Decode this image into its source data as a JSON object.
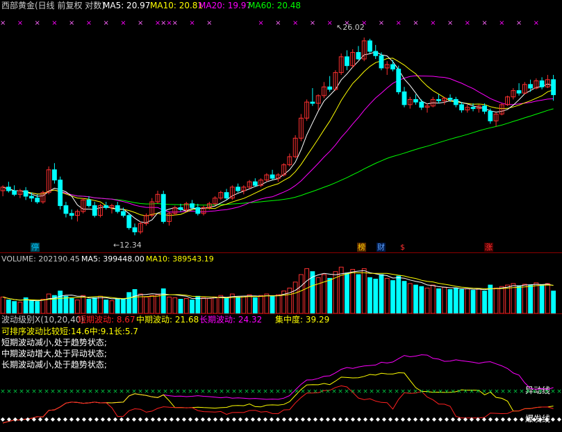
{
  "colors": {
    "ma5": "#ffffff",
    "ma10": "#ffff00",
    "ma20": "#ff00ff",
    "ma60": "#00ff00",
    "up": "#ff3030",
    "down": "#00ffff",
    "short": "#ff2020",
    "mid": "#ffff00",
    "long": "#ff00ff"
  },
  "price_header": {
    "title": "西部黄金(日线 前复权 对数)",
    "ma5": "MA5: 20.97",
    "ma10": "MA10: 20.81",
    "ma20": "MA20: 19.97",
    "ma60": "MA60: 20.48"
  },
  "price_annotations": {
    "high": "26.02",
    "low": "12.34"
  },
  "event_tags": {
    "t1": "停",
    "t2": "榜",
    "t3": "财",
    "t4": "$",
    "t5": "涨"
  },
  "volume_header": {
    "label": "VOLUME: 202190.45",
    "ma5": "MA5: 399448.00",
    "ma10": "MA10: 389543.19"
  },
  "wave_header": {
    "name": "波动级别X(10,20,40)",
    "short": "短期波动: 8.67",
    "mid": "中期波动: 21.68",
    "long": "长期波动: 24.32",
    "conc": "集中度: 39.29"
  },
  "wave_notes": {
    "line1": "可排序波动比较短:14.6中:9.1长:5.7",
    "line2": "短期波动减小,处于趋势状态;",
    "line3": "中期波动增大,处于异动状态;",
    "line4": "长期波动减小,处于趋势状态;"
  },
  "wave_labels": {
    "abnormal": "异动线",
    "explosive": "爆发线"
  },
  "icons": {
    "marker": "x-marker-icon",
    "pointer": "arrow-pointer-icon"
  },
  "chart_data": [
    {
      "type": "line",
      "title": "西部黄金(日线 前复权 对数)",
      "series": [
        {
          "name": "MA5",
          "last": 20.97
        },
        {
          "name": "MA10",
          "last": 20.81
        },
        {
          "name": "MA20",
          "last": 19.97
        },
        {
          "name": "MA60",
          "last": 20.48
        }
      ],
      "candles": [
        [
          14.6,
          14.9,
          14.3,
          14.8
        ],
        [
          14.8,
          15.1,
          14.5,
          14.6
        ],
        [
          14.6,
          14.9,
          14.3,
          14.4
        ],
        [
          14.4,
          14.7,
          14.2,
          14.6
        ],
        [
          14.6,
          14.8,
          14.1,
          14.3
        ],
        [
          14.3,
          14.5,
          14.0,
          14.2
        ],
        [
          14.2,
          14.4,
          13.9,
          14.0
        ],
        [
          14.0,
          14.6,
          13.9,
          14.5
        ],
        [
          14.5,
          16.0,
          14.4,
          15.8
        ],
        [
          15.8,
          16.2,
          15.0,
          15.2
        ],
        [
          15.2,
          15.4,
          13.6,
          13.8
        ],
        [
          13.8,
          14.0,
          13.2,
          13.4
        ],
        [
          13.4,
          13.6,
          13.1,
          13.3
        ],
        [
          13.3,
          13.6,
          13.0,
          13.5
        ],
        [
          13.5,
          14.2,
          13.4,
          14.1
        ],
        [
          14.1,
          14.3,
          13.7,
          13.8
        ],
        [
          13.8,
          14.0,
          13.2,
          13.3
        ],
        [
          13.3,
          13.9,
          13.2,
          13.8
        ],
        [
          13.8,
          14.0,
          13.6,
          13.7
        ],
        [
          13.7,
          13.9,
          13.4,
          13.8
        ],
        [
          13.8,
          14.0,
          13.4,
          13.5
        ],
        [
          13.5,
          13.7,
          13.2,
          13.3
        ],
        [
          13.3,
          13.4,
          12.6,
          12.7
        ],
        [
          12.7,
          12.9,
          12.34,
          12.5
        ],
        [
          12.5,
          13.0,
          12.4,
          12.9
        ],
        [
          12.9,
          13.4,
          12.8,
          13.3
        ],
        [
          13.3,
          14.2,
          13.2,
          14.0
        ],
        [
          14.0,
          14.6,
          13.9,
          14.4
        ],
        [
          14.4,
          14.6,
          12.9,
          13.0
        ],
        [
          13.0,
          13.5,
          12.8,
          13.4
        ],
        [
          13.4,
          13.8,
          13.3,
          13.7
        ],
        [
          13.7,
          13.9,
          13.5,
          13.6
        ],
        [
          13.6,
          14.0,
          13.5,
          13.9
        ],
        [
          13.9,
          14.1,
          13.6,
          13.7
        ],
        [
          13.7,
          13.9,
          13.3,
          13.4
        ],
        [
          13.4,
          13.8,
          13.3,
          13.7
        ],
        [
          13.7,
          14.0,
          13.6,
          13.9
        ],
        [
          13.9,
          14.3,
          13.8,
          14.2
        ],
        [
          14.2,
          14.6,
          14.1,
          14.5
        ],
        [
          14.5,
          14.7,
          14.1,
          14.2
        ],
        [
          14.2,
          14.9,
          14.1,
          14.8
        ],
        [
          14.8,
          15.0,
          14.5,
          14.6
        ],
        [
          14.6,
          14.9,
          14.4,
          14.8
        ],
        [
          14.8,
          15.2,
          14.7,
          15.1
        ],
        [
          15.1,
          15.3,
          14.8,
          14.9
        ],
        [
          14.9,
          15.3,
          14.8,
          15.2
        ],
        [
          15.2,
          15.6,
          15.1,
          15.5
        ],
        [
          15.5,
          15.8,
          15.2,
          15.3
        ],
        [
          15.3,
          15.6,
          15.1,
          15.5
        ],
        [
          15.5,
          16.2,
          15.4,
          16.1
        ],
        [
          16.1,
          16.8,
          16.0,
          16.6
        ],
        [
          16.6,
          18.0,
          16.5,
          17.8
        ],
        [
          17.8,
          19.5,
          17.6,
          19.2
        ],
        [
          19.2,
          20.6,
          19.0,
          20.4
        ],
        [
          20.4,
          21.5,
          20.1,
          20.3
        ],
        [
          20.3,
          21.0,
          19.8,
          20.9
        ],
        [
          20.9,
          22.0,
          20.7,
          21.6
        ],
        [
          21.6,
          22.5,
          21.2,
          21.4
        ],
        [
          21.4,
          23.0,
          21.3,
          22.8
        ],
        [
          22.8,
          24.5,
          22.6,
          24.2
        ],
        [
          24.2,
          24.8,
          23.0,
          23.4
        ],
        [
          23.4,
          24.9,
          23.2,
          24.6
        ],
        [
          24.6,
          25.2,
          23.9,
          24.0
        ],
        [
          24.0,
          26.02,
          23.8,
          25.7
        ],
        [
          25.7,
          25.9,
          24.5,
          24.7
        ],
        [
          24.7,
          25.3,
          24.0,
          24.3
        ],
        [
          24.3,
          24.6,
          23.0,
          23.2
        ],
        [
          23.2,
          23.8,
          22.6,
          23.5
        ],
        [
          23.5,
          23.9,
          22.9,
          23.1
        ],
        [
          23.1,
          23.4,
          21.0,
          21.2
        ],
        [
          21.2,
          21.6,
          20.0,
          20.2
        ],
        [
          20.2,
          20.8,
          19.9,
          20.6
        ],
        [
          20.6,
          21.0,
          20.2,
          20.4
        ],
        [
          20.4,
          20.6,
          19.8,
          20.0
        ],
        [
          20.0,
          20.3,
          19.6,
          20.1
        ],
        [
          20.1,
          20.8,
          20.0,
          20.6
        ],
        [
          20.6,
          21.0,
          20.3,
          20.5
        ],
        [
          20.5,
          20.8,
          20.2,
          20.7
        ],
        [
          20.7,
          21.0,
          20.4,
          20.6
        ],
        [
          20.6,
          20.8,
          20.0,
          20.2
        ],
        [
          20.2,
          20.4,
          19.6,
          19.8
        ],
        [
          19.8,
          20.2,
          19.6,
          20.0
        ],
        [
          20.0,
          20.3,
          19.7,
          19.9
        ],
        [
          19.9,
          20.2,
          19.6,
          20.1
        ],
        [
          20.1,
          20.3,
          19.5,
          19.7
        ],
        [
          19.7,
          19.9,
          18.8,
          19.0
        ],
        [
          19.0,
          19.6,
          18.6,
          19.5
        ],
        [
          19.5,
          20.3,
          19.4,
          20.2
        ],
        [
          20.2,
          20.9,
          20.1,
          20.8
        ],
        [
          20.8,
          21.5,
          20.6,
          21.3
        ],
        [
          21.3,
          21.9,
          20.9,
          21.1
        ],
        [
          21.1,
          22.0,
          21.0,
          21.8
        ],
        [
          21.8,
          22.2,
          21.2,
          21.5
        ],
        [
          21.5,
          22.3,
          21.4,
          22.1
        ],
        [
          22.1,
          22.4,
          21.4,
          21.6
        ],
        [
          21.6,
          22.6,
          21.5,
          22.2
        ],
        [
          22.2,
          22.6,
          20.5,
          20.97
        ]
      ]
    },
    {
      "type": "bar",
      "title": "VOLUME",
      "series": [
        {
          "name": "VOLUME",
          "last": 202190.45
        },
        {
          "name": "MA5",
          "last": 399448.0
        },
        {
          "name": "MA10",
          "last": 389543.19
        }
      ],
      "values": [
        220,
        180,
        160,
        150,
        210,
        170,
        160,
        190,
        260,
        240,
        300,
        230,
        200,
        180,
        240,
        190,
        210,
        230,
        180,
        170,
        200,
        190,
        280,
        320,
        260,
        220,
        240,
        250,
        330,
        220,
        210,
        190,
        200,
        180,
        230,
        210,
        200,
        220,
        240,
        210,
        260,
        220,
        230,
        250,
        210,
        240,
        260,
        230,
        250,
        300,
        340,
        420,
        520,
        600,
        560,
        480,
        520,
        470,
        560,
        620,
        540,
        590,
        520,
        600,
        480,
        460,
        520,
        470,
        440,
        500,
        430,
        400,
        380,
        360,
        340,
        380,
        330,
        350,
        320,
        340,
        320,
        330,
        310,
        330,
        300,
        380,
        340,
        360,
        380,
        400,
        370,
        390,
        380,
        410,
        380,
        400,
        300
      ]
    },
    {
      "type": "line",
      "title": "波动级别X(10,20,40)",
      "series": [
        {
          "name": "短期波动",
          "last": 8.67
        },
        {
          "name": "中期波动",
          "last": 21.68
        },
        {
          "name": "长期波动",
          "last": 24.32
        },
        {
          "name": "集中度",
          "last": 39.29
        }
      ]
    }
  ]
}
